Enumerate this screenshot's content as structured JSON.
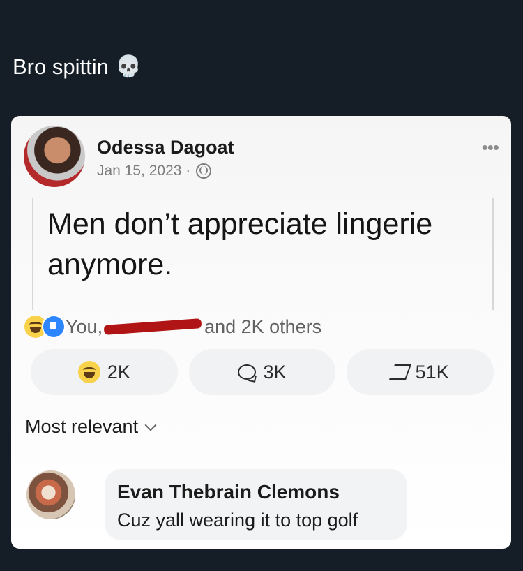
{
  "caption": {
    "text": "Bro spittin",
    "emoji": "💀"
  },
  "post": {
    "author": "Odessa Dagoat",
    "date": "Jan 15, 2023 ·",
    "text": "Men don’t appreciate lingerie anymore.",
    "reactions_prefix": "You,",
    "reactions_suffix": "and 2K others"
  },
  "actions": {
    "reactions": "2K",
    "comments": "3K",
    "shares": "51K"
  },
  "sort": {
    "label": "Most relevant"
  },
  "comment": {
    "name": "Evan Thebrain Clemons",
    "text": "Cuz yall wearing it to top golf"
  },
  "icons": {
    "skull": "skull-icon",
    "globe": "globe-icon",
    "more": "more-icon",
    "haha": "haha-icon",
    "like": "like-icon",
    "comment": "comment-icon",
    "share": "share-icon",
    "chevron": "chevron-down-icon"
  },
  "colors": {
    "page_background": "#151d27",
    "card_background": "#ffffff",
    "accent_blue": "#2d86ff",
    "redaction_red": "#b01414"
  }
}
